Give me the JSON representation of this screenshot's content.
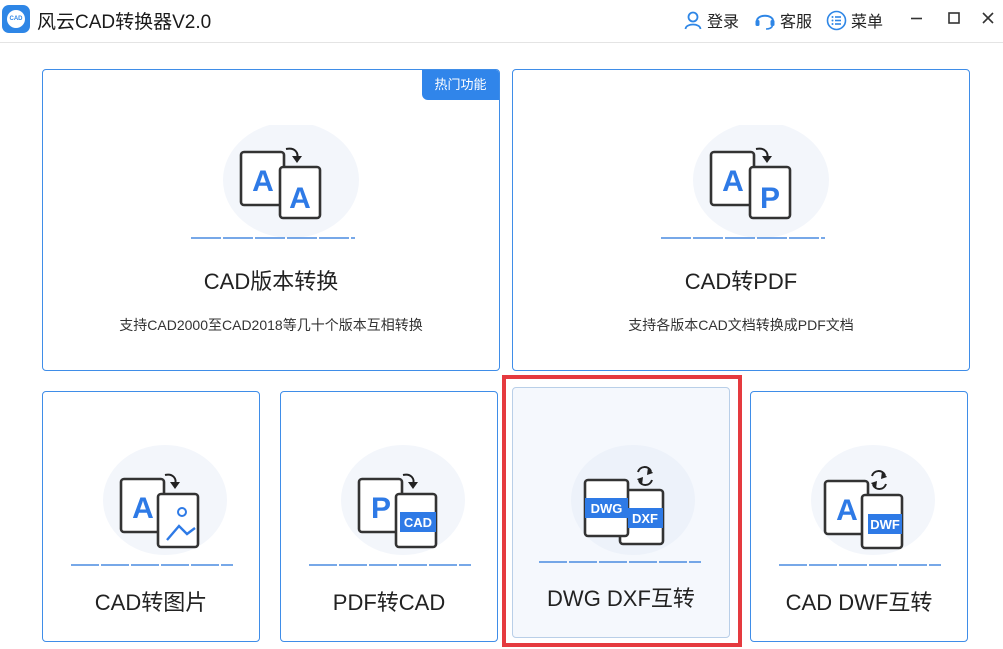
{
  "app": {
    "title": "风云CAD转换器V2.0",
    "logo_text": "CAD"
  },
  "header": {
    "login": "登录",
    "service": "客服",
    "menu": "菜单"
  },
  "cards": {
    "version": {
      "title": "CAD版本转换",
      "desc": "支持CAD2000至CAD2018等几十个版本互相转换",
      "badge": "热门功能",
      "glyph1": "A",
      "glyph2": "A"
    },
    "pdf": {
      "title": "CAD转PDF",
      "desc": "支持各版本CAD文档转换成PDF文档",
      "glyph1": "A",
      "glyph2": "P"
    },
    "image": {
      "title": "CAD转图片",
      "glyph1": "A"
    },
    "pdf2cad": {
      "title": "PDF转CAD",
      "glyph1": "P",
      "glyph2": "CAD"
    },
    "dwgdxf": {
      "title": "DWG DXF互转",
      "glyph1": "DWG",
      "glyph2": "DXF"
    },
    "caddwf": {
      "title": "CAD DWF互转",
      "glyph1": "A",
      "glyph2": "DWF"
    }
  },
  "colors": {
    "accent": "#3085ea",
    "highlight": "#e53a3f"
  }
}
